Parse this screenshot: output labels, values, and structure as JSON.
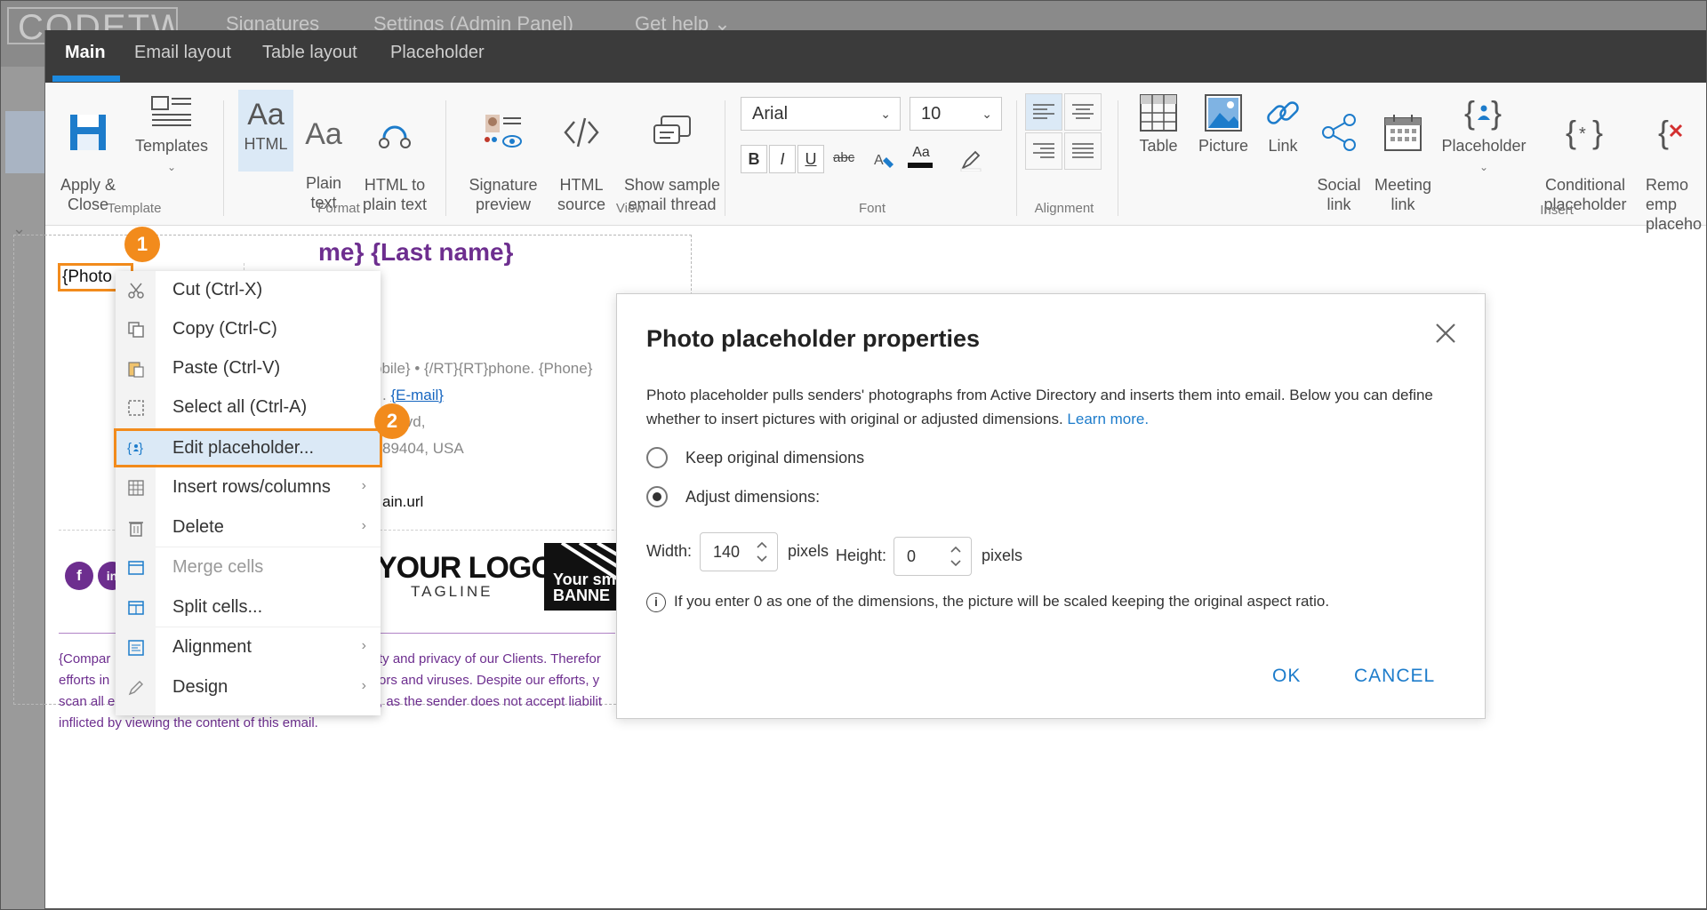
{
  "background_app": {
    "logo_text": "CODETWO",
    "nav": [
      "Signatures",
      "Settings (Admin Panel)",
      "Get help ⌄"
    ]
  },
  "tabs": [
    {
      "label": "Main",
      "active": true
    },
    {
      "label": "Email layout",
      "active": false
    },
    {
      "label": "Table layout",
      "active": false
    },
    {
      "label": "Placeholder",
      "active": false
    }
  ],
  "ribbon": {
    "template": {
      "group": "Template",
      "apply_close": "Apply &\nClose",
      "templates": "Templates"
    },
    "format": {
      "group": "Format",
      "html": "HTML",
      "plain_text": "Plain\ntext",
      "html_to_plain": "HTML to\nplain text",
      "aa": "Aa"
    },
    "view": {
      "group": "View",
      "signature_preview": "Signature\npreview",
      "html_source": "HTML\nsource",
      "show_sample": "Show sample\nemail thread"
    },
    "font": {
      "group": "Font",
      "family": "Arial",
      "size": "10",
      "bold": "B",
      "italic": "I",
      "underline": "U",
      "strike": "abc",
      "case": "Aa"
    },
    "alignment": {
      "group": "Alignment"
    },
    "insert": {
      "group": "Insert",
      "table": "Table",
      "picture": "Picture",
      "link": "Link",
      "social_link": "Social\nlink",
      "meeting_link": "Meeting\nlink",
      "placeholder": "Placeholder",
      "conditional_placeholder": "Conditional\nplaceholder",
      "remove_empty": "Remo\nemp\nplaceho"
    }
  },
  "canvas": {
    "photo_placeholder": "{Photo",
    "name_line": "me} {Last name}",
    "lines": [
      "obile} • {/RT}{RT}phone. {Phone}",
      "lvd,",
      "89404, USA",
      "ain.url"
    ],
    "email_link": "{E-mail}",
    "email_prefix": ". ",
    "logo": "YOUR LOGO",
    "tagline": "TAGLINE",
    "banner": "Your sm\nBANNE",
    "social_f": "f",
    "social_in": "in",
    "disclaimer": [
      "{Compar",
      "efforts in",
      "scan all e",
      "inflicted by viewing the content of this email."
    ],
    "disclaimer_right": [
      "ty and privacy of our Clients. Therefor",
      "ors and viruses. Despite our efforts, y",
      ", as the sender does not accept liabilit"
    ]
  },
  "badges": {
    "one": "1",
    "two": "2"
  },
  "context_menu": [
    {
      "label": "Cut (Ctrl-X)",
      "icon": "scissors-icon"
    },
    {
      "label": "Copy (Ctrl-C)",
      "icon": "copy-icon"
    },
    {
      "label": "Paste (Ctrl-V)",
      "icon": "paste-icon"
    },
    {
      "label": "Select all (Ctrl-A)",
      "icon": "select-all-icon"
    },
    {
      "label": "Edit placeholder...",
      "icon": "placeholder-icon",
      "highlighted": true
    },
    {
      "label": "Insert rows/columns",
      "icon": "table-grid-icon",
      "submenu": true
    },
    {
      "label": "Delete",
      "icon": "trash-icon",
      "submenu": true
    },
    {
      "label": "Merge cells",
      "icon": "merge-cells-icon",
      "disabled": true
    },
    {
      "label": "Split cells...",
      "icon": "split-cells-icon"
    },
    {
      "label": "Alignment",
      "icon": "alignment-icon",
      "submenu": true
    },
    {
      "label": "Design",
      "icon": "pencil-icon",
      "submenu": true
    }
  ],
  "dialog": {
    "title": "Photo placeholder properties",
    "description": "Photo placeholder pulls senders' photographs from Active Directory and inserts them into email. Below you can define whether to insert pictures with original or adjusted dimensions.",
    "learn_more": "Learn more.",
    "option_keep": "Keep original dimensions",
    "option_adjust": "Adjust dimensions:",
    "selected_option": "adjust",
    "width_label": "Width:",
    "width_value": "140",
    "height_label": "Height:",
    "height_value": "0",
    "pixels": "pixels",
    "info": "If you enter 0 as one of the dimensions, the picture will be scaled keeping the original aspect ratio.",
    "info_icon": "i",
    "ok": "OK",
    "cancel": "CANCEL"
  },
  "colors": {
    "accent": "#1d8ae0",
    "highlight": "#f28b1c",
    "brand_purple": "#6d2e8f",
    "link": "#1d7ccb"
  }
}
